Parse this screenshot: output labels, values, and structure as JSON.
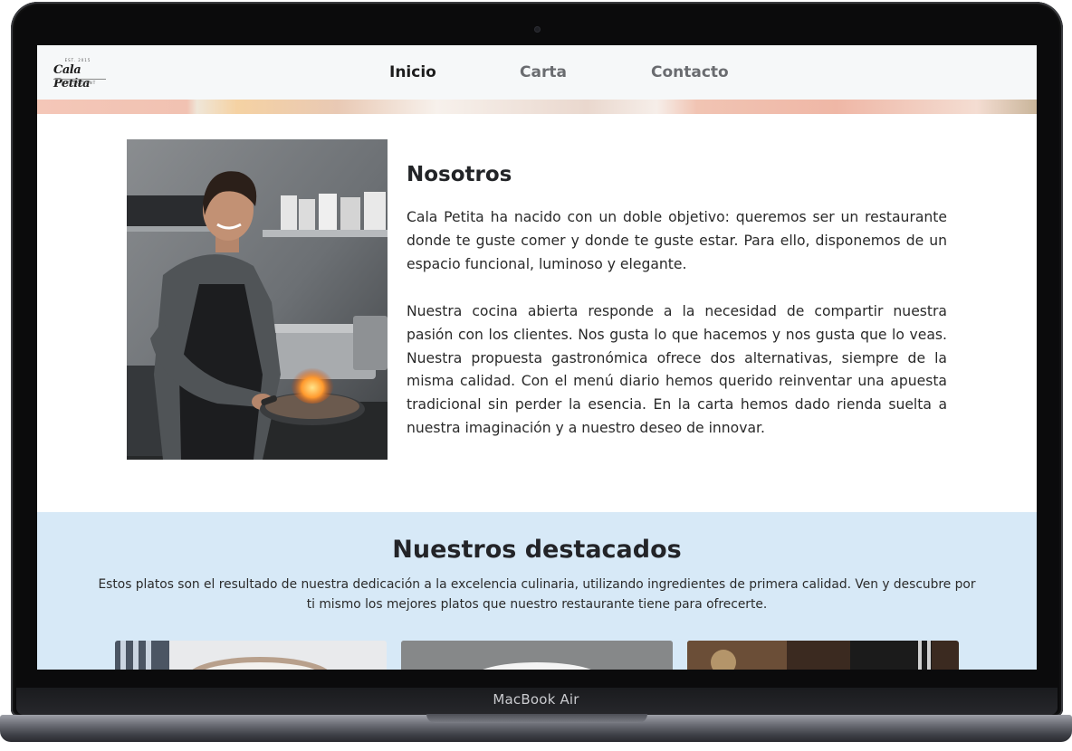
{
  "device": {
    "label": "MacBook Air"
  },
  "site": {
    "logo": {
      "name": "Cala Petita",
      "top_text": "EST. 2015",
      "sub_text": "RESTAURANT"
    },
    "nav": {
      "items": [
        "Inicio",
        "Carta",
        "Contacto"
      ],
      "active": "Inicio"
    },
    "about": {
      "title": "Nosotros",
      "paragraphs": [
        "Cala Petita ha nacido con un doble objetivo: queremos ser un restaurante donde te guste comer y donde te guste estar. Para ello, disponemos de un espacio funcional, luminoso y elegante.",
        "Nuestra cocina abierta responde a la necesidad de compartir nuestra pasión con los clientes. Nos gusta lo que hacemos y nos gusta que lo veas. Nuestra propuesta gastronómica ofrece dos alternativas, siempre de la misma calidad. Con el menú diario hemos querido reinventar una apuesta tradicional sin perder la esencia. En la carta hemos dado rienda suelta a nuestra imaginación y a nuestro deseo de innovar."
      ]
    },
    "featured": {
      "title": "Nuestros destacados",
      "description": "Estos platos son el resultado de nuestra dedicación a la excelencia culinaria, utilizando ingredientes de primera calidad. Ven y descubre por ti mismo los mejores platos que nuestro restaurante tiene para ofrecerte."
    }
  },
  "colors": {
    "navbar_bg": "#f6f8f9",
    "featured_bg": "#d7e9f7",
    "active_nav": "#1d1d1d",
    "inactive_nav": "#6a6c70"
  }
}
